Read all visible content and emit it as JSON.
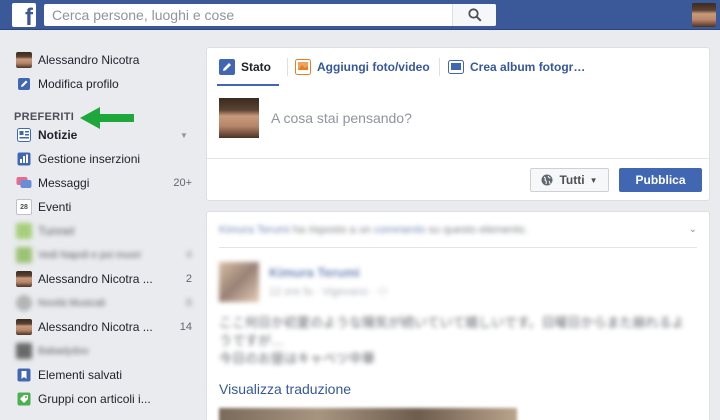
{
  "topbar": {
    "logo_letter": "f",
    "search_placeholder": "Cerca persone, luoghi e cose",
    "search_value": ""
  },
  "sidebar": {
    "profile_name": "Alessandro Nicotra",
    "edit_profile": "Modifica profilo",
    "favorites_title": "PREFERITI",
    "items": [
      {
        "label": "Notizie",
        "count": "",
        "icon": "news-feed-icon"
      },
      {
        "label": "Gestione inserzioni",
        "count": "",
        "icon": "ads-manager-icon"
      },
      {
        "label": "Messaggi",
        "count": "20+",
        "icon": "messages-icon"
      },
      {
        "label": "Eventi",
        "count": "",
        "icon": "events-calendar-icon",
        "icon_text": "28"
      },
      {
        "label": "Tunnel",
        "count": "",
        "icon": "group-icon"
      },
      {
        "label": "Vedi Napoli e poi muori",
        "count": "4",
        "icon": "group-icon"
      },
      {
        "label": "Alessandro Nicotra ...",
        "count": "2",
        "icon": "avatar"
      },
      {
        "label": "Novità Musicali",
        "count": "8",
        "icon": "group-icon"
      },
      {
        "label": "Alessandro Nicotra ...",
        "count": "14",
        "icon": "avatar"
      },
      {
        "label": "Babadydoo",
        "count": "",
        "icon": "page-icon"
      },
      {
        "label": "Elementi salvati",
        "count": "",
        "icon": "saved-bookmark-icon"
      },
      {
        "label": "Gruppi con articoli i...",
        "count": "",
        "icon": "groups-sale-icon"
      }
    ]
  },
  "composer": {
    "tab_status": "Stato",
    "tab_photo": "Aggiungi foto/video",
    "tab_album": "Crea album fotogr…",
    "placeholder": "A cosa stai pensando?",
    "audience": "Tutti",
    "publish": "Pubblica"
  },
  "post": {
    "story_actor": "Kimura Terumi",
    "story_mid": " ha risposto a un ",
    "story_link": "commento",
    "story_end": " su questo elemento.",
    "author": "Kimura Terumi",
    "meta": "12 ore fa · Vigevano · ⚇",
    "text_line1": "ここ何日か初夏のような陽気が続いていて嬉しいです。日曜日からまた崩れるようですが…",
    "text_line2": "今日のお昼はキャベツ中華",
    "translate": "Visualizza traduzione"
  },
  "colors": {
    "brand": "#3b5998",
    "accent": "#4267b2",
    "link": "#365899",
    "arrow": "#1ea73a"
  }
}
